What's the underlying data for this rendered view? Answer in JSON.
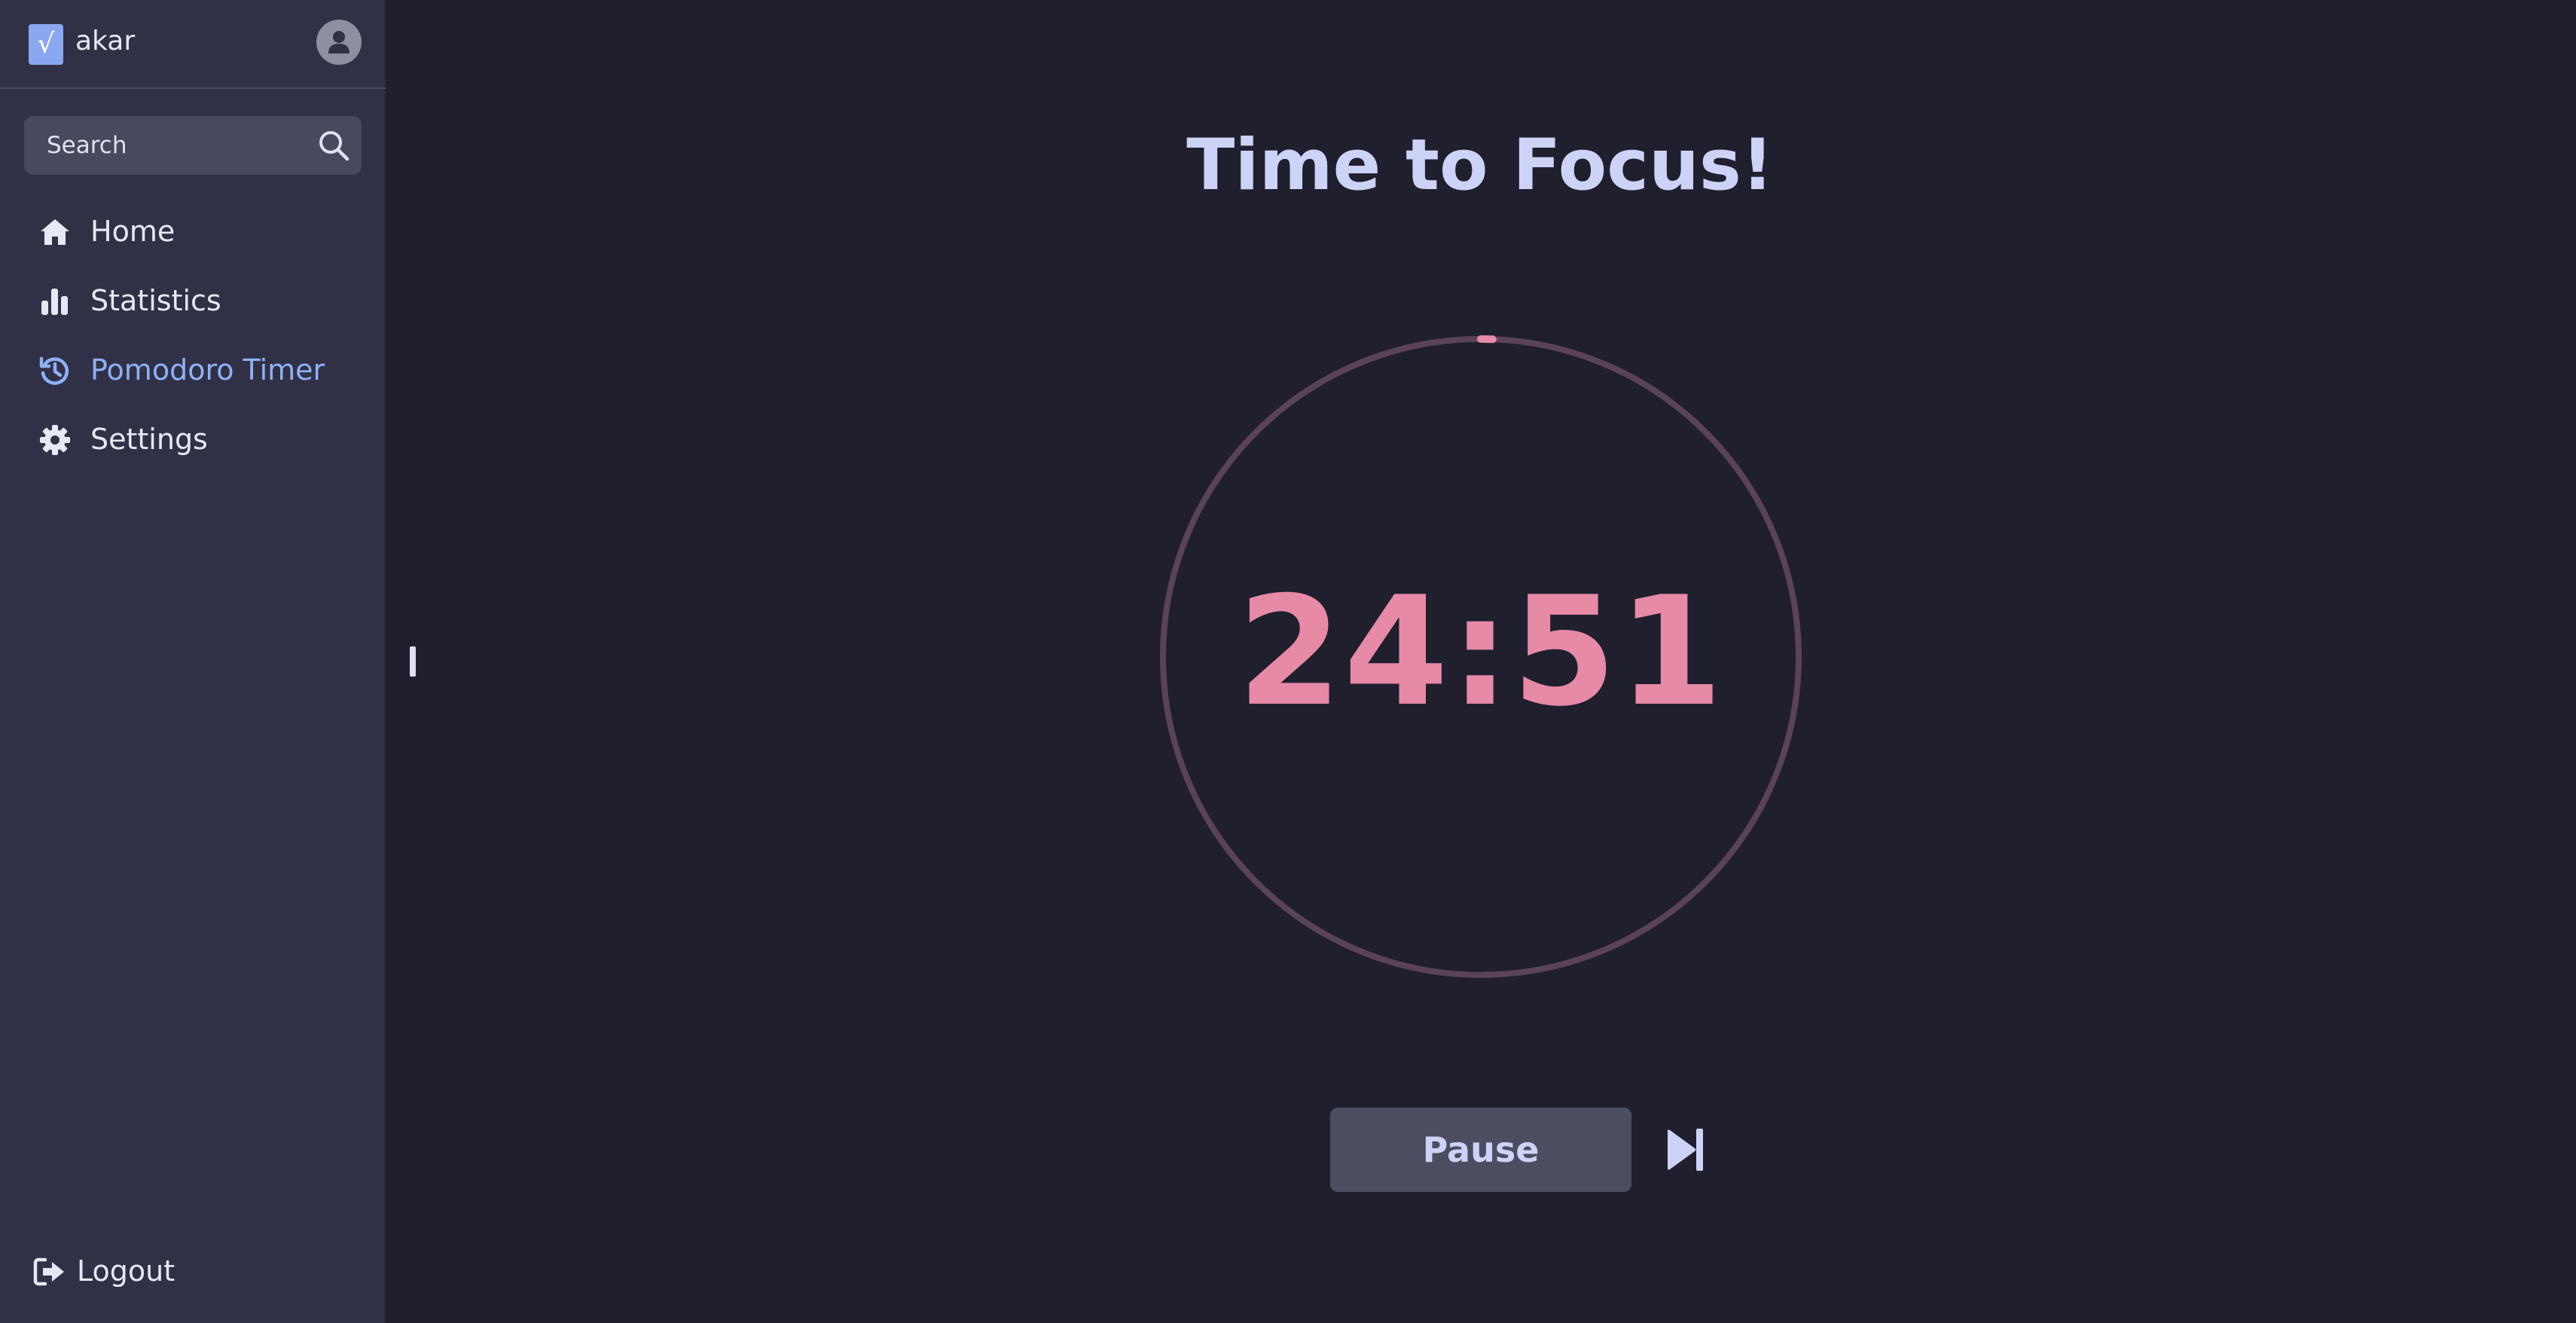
{
  "app": {
    "logo_glyph": "√",
    "username": "akar"
  },
  "search": {
    "placeholder": "Search"
  },
  "sidebar": {
    "items": [
      {
        "label": "Home",
        "icon": "home-icon",
        "active": false
      },
      {
        "label": "Statistics",
        "icon": "bar-chart-icon",
        "active": false
      },
      {
        "label": "Pomodoro Timer",
        "icon": "history-icon",
        "active": true
      },
      {
        "label": "Settings",
        "icon": "gear-icon",
        "active": false
      }
    ],
    "logout_label": "Logout"
  },
  "main": {
    "title": "Time to Focus!",
    "timer": "24:51",
    "progress_fraction": 0.006,
    "pause_label": "Pause"
  },
  "colors": {
    "background": "#1f1f2e",
    "sidebar": "#303146",
    "accent": "#8fb0f6",
    "timer": "#e68aa5",
    "ring_track": "#5a4358",
    "title": "#cdd3f6"
  }
}
